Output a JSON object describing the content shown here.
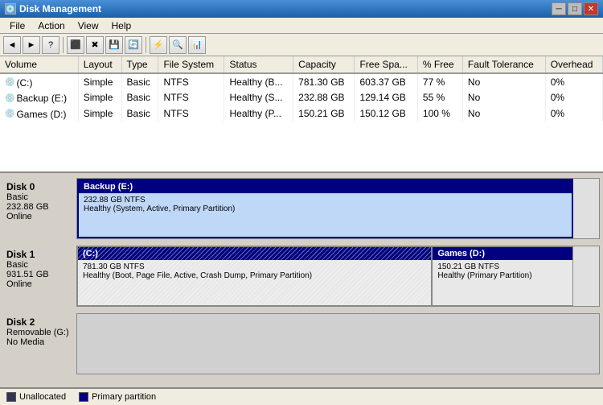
{
  "window": {
    "title": "Disk Management",
    "icon": "🖥"
  },
  "menu": {
    "items": [
      "File",
      "Action",
      "View",
      "Help"
    ]
  },
  "toolbar": {
    "buttons": [
      "←",
      "→",
      "?",
      "⬛",
      "✖",
      "💾",
      "🔄",
      "⚡",
      "🔍",
      "📊"
    ]
  },
  "table": {
    "headers": [
      "Volume",
      "Layout",
      "Type",
      "File System",
      "Status",
      "Capacity",
      "Free Spa...",
      "% Free",
      "Fault Tolerance",
      "Overhead"
    ],
    "rows": [
      {
        "volume": "(C:)",
        "layout": "Simple",
        "type": "Basic",
        "fs": "NTFS",
        "status": "Healthy (B...",
        "capacity": "781.30 GB",
        "free": "603.37 GB",
        "pct": "77 %",
        "fault": "No",
        "overhead": "0%"
      },
      {
        "volume": "Backup (E:)",
        "layout": "Simple",
        "type": "Basic",
        "fs": "NTFS",
        "status": "Healthy (S...",
        "capacity": "232.88 GB",
        "free": "129.14 GB",
        "pct": "55 %",
        "fault": "No",
        "overhead": "0%"
      },
      {
        "volume": "Games (D:)",
        "layout": "Simple",
        "type": "Basic",
        "fs": "NTFS",
        "status": "Healthy (P...",
        "capacity": "150.21 GB",
        "free": "150.12 GB",
        "pct": "100 %",
        "fault": "No",
        "overhead": "0%"
      }
    ]
  },
  "disks": [
    {
      "id": "Disk 0",
      "type": "Basic",
      "size": "232.88 GB",
      "status": "Online",
      "partitions": [
        {
          "name": "Backup (E:)",
          "details": "232.88 GB NTFS",
          "health": "Healthy (System, Active, Primary Partition)",
          "width_pct": 95,
          "hatch": false,
          "selected": true
        }
      ]
    },
    {
      "id": "Disk 1",
      "type": "Basic",
      "size": "931.51 GB",
      "status": "Online",
      "partitions": [
        {
          "name": "(C:)",
          "details": "781.30 GB NTFS",
          "health": "Healthy (Boot, Page File, Active, Crash Dump, Primary Partition)",
          "width_pct": 68,
          "hatch": true,
          "selected": false
        },
        {
          "name": "Games (D:)",
          "details": "150.21 GB NTFS",
          "health": "Healthy (Primary Partition)",
          "width_pct": 27,
          "hatch": false,
          "selected": false
        }
      ]
    },
    {
      "id": "Disk 2",
      "type": "Removable (G:)",
      "size": "",
      "status": "No Media",
      "partitions": []
    }
  ],
  "legend": {
    "items": [
      {
        "label": "Unallocated",
        "color": "#333355"
      },
      {
        "label": "Primary partition",
        "color": "#000080"
      }
    ]
  }
}
